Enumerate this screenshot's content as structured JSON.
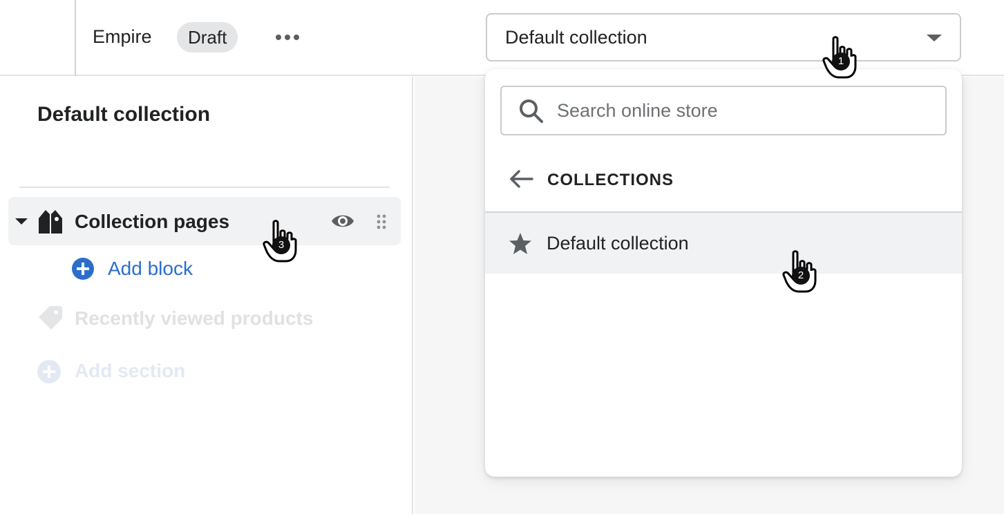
{
  "topbar": {
    "theme_name": "Empire",
    "status_badge": "Draft",
    "more_icon": "more-horizontal-icon",
    "collection_select": {
      "selected": "Default collection",
      "caret_icon": "caret-down-icon"
    }
  },
  "sidebar": {
    "title": "Default collection",
    "sections": [
      {
        "label": "Collection pages",
        "icon": "collection-tag-icon",
        "expanded": true,
        "actions": [
          "eye-icon",
          "drag-handle-icon"
        ],
        "add_block_label": "Add block"
      },
      {
        "label": "Recently viewed products",
        "icon": "tag-icon",
        "disabled": true
      }
    ],
    "add_section_label": "Add section"
  },
  "dropdown": {
    "search_placeholder": "Search online store",
    "back_label": "COLLECTIONS",
    "options": [
      {
        "label": "Default collection",
        "icon": "star-icon",
        "highlighted": true
      }
    ]
  },
  "callouts": [
    "1",
    "2",
    "3"
  ],
  "colors": {
    "accent_link": "#2c6ecb",
    "text": "#202223",
    "badge_bg": "#e4e5e7",
    "row_highlight": "#f1f2f3",
    "disabled_text": "#dfe1e3"
  }
}
